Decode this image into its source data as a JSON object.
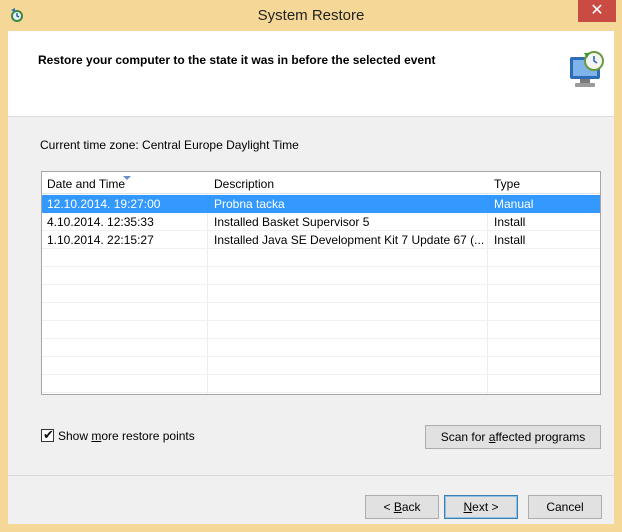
{
  "window": {
    "title": "System Restore",
    "close_label": "✕",
    "colors": {
      "frame": "#f5d898",
      "close": "#c94b43",
      "selection": "#3399ff"
    }
  },
  "header": {
    "text": "Restore your computer to the state it was in before the selected event"
  },
  "timezone_text": "Current time zone: Central Europe Daylight Time",
  "table": {
    "columns": [
      "Date and Time",
      "Description",
      "Type"
    ],
    "rows": [
      {
        "date": "12.10.2014. 19:27:00",
        "description": "Probna tacka",
        "type": "Manual",
        "selected": true
      },
      {
        "date": "4.10.2014. 12:35:33",
        "description": "Installed Basket Supervisor 5",
        "type": "Install",
        "selected": false
      },
      {
        "date": "1.10.2014. 22:15:27",
        "description": "Installed Java SE Development Kit 7 Update 67 (...",
        "type": "Install",
        "selected": false
      }
    ]
  },
  "show_more": {
    "checked": true,
    "label_pre": "Show ",
    "label_u": "m",
    "label_post": "ore restore points"
  },
  "buttons": {
    "scan_pre": "Scan for ",
    "scan_u": "a",
    "scan_post": "ffected programs",
    "back_pre": "< ",
    "back_u": "B",
    "back_post": "ack",
    "next_u": "N",
    "next_post": "ext >",
    "cancel": "Cancel"
  }
}
